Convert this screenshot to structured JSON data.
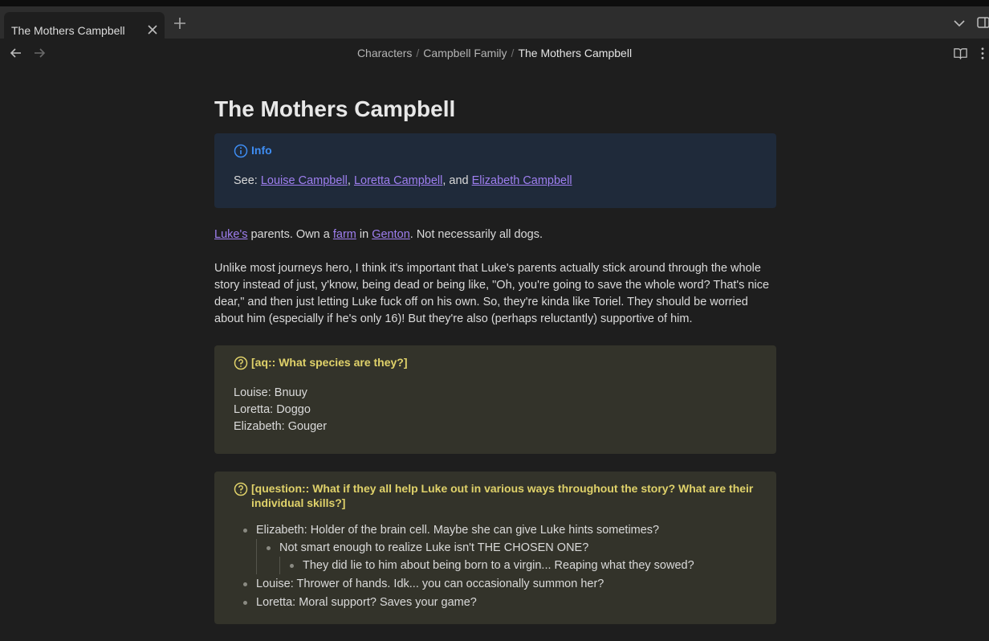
{
  "tab": {
    "title": "The Mothers Campbell"
  },
  "breadcrumb": {
    "items": [
      "Characters",
      "Campbell Family"
    ],
    "separator": "/",
    "current": "The Mothers Campbell"
  },
  "note": {
    "title": "The Mothers Campbell",
    "info_callout": {
      "label": "Info",
      "see": "See: ",
      "links": [
        "Louise Campbell",
        "Loretta Campbell",
        "Elizabeth Campbell"
      ],
      "sep1": ", ",
      "sep2": ", and "
    },
    "para1": {
      "link_luke": "Luke's",
      "t1": " parents. Own a ",
      "link_farm": "farm",
      "t2": " in ",
      "link_genton": "Genton",
      "t3": ". Not necessarily all dogs."
    },
    "para2": "Unlike most journeys hero, I think it's important that Luke's parents actually stick around through the whole story instead of just, y'know, being dead or being like, \"Oh, you're going to save the whole word? That's nice dear,\" and then just letting Luke fuck off on his own. So, they're kinda like Toriel. They should be worried about him (especially if he's only 16)! But they're also (perhaps reluctantly) supportive of him.",
    "aq_callout": {
      "title": "[aq:: What species are they?]",
      "lines": [
        "Louise: Bnuuy",
        "Loretta: Doggo",
        "Elizabeth: Gouger"
      ]
    },
    "question_callout": {
      "title": "[question:: What if they all help Luke out in various ways throughout the story? What are their individual skills?]",
      "items": [
        "Elizabeth: Holder of the brain cell. Maybe she can give Luke hints sometimes?",
        "Not smart enough to realize Luke isn't THE CHOSEN ONE?",
        "They did lie to him about being born to a virgin... Reaping what they sowed?",
        "Louise: Thrower of hands. Idk... you can occasionally summon her?",
        "Loretta: Moral support? Saves your game?"
      ]
    }
  },
  "colors": {
    "background": "#1e1e1e",
    "tabbar": "#2d2d2d",
    "link": "#9f7ff0",
    "info_accent": "#3e8df3",
    "question_accent": "#e0d26a"
  },
  "icons": [
    "close-icon",
    "plus-icon",
    "chevron-down-icon",
    "sidebar-toggle-icon",
    "arrow-left-icon",
    "arrow-right-icon",
    "book-open-icon",
    "more-vertical-icon",
    "info-icon",
    "help-circle-icon"
  ]
}
